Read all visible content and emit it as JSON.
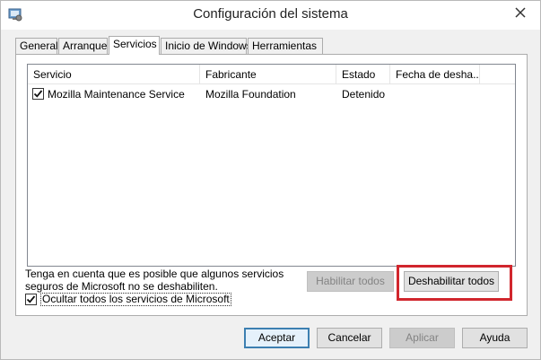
{
  "window": {
    "title": "Configuración del sistema",
    "icon": "system-config-icon",
    "close": "close-icon"
  },
  "tabs": [
    {
      "label": "General",
      "active": false
    },
    {
      "label": "Arranque",
      "active": false
    },
    {
      "label": "Servicios",
      "active": true
    },
    {
      "label": "Inicio de Windows",
      "active": false
    },
    {
      "label": "Herramientas",
      "active": false
    }
  ],
  "services": {
    "columns": [
      "Servicio",
      "Fabricante",
      "Estado",
      "Fecha de desha..."
    ],
    "rows": [
      {
        "checked": true,
        "name": "Mozilla Maintenance Service",
        "manufacturer": "Mozilla Foundation",
        "status": "Detenido",
        "date": ""
      }
    ]
  },
  "note": "Tenga en cuenta que es posible que algunos servicios seguros de Microsoft no se deshabiliten.",
  "hide_ms": {
    "label": "Ocultar todos los servicios de Microsoft",
    "checked": true
  },
  "buttons": {
    "enable_all": "Habilitar todos",
    "disable_all": "Deshabilitar todos",
    "ok": "Aceptar",
    "cancel": "Cancelar",
    "apply": "Aplicar",
    "help": "Ayuda"
  },
  "colors": {
    "highlight": "#d1262d",
    "accent": "#3c7fb1"
  }
}
